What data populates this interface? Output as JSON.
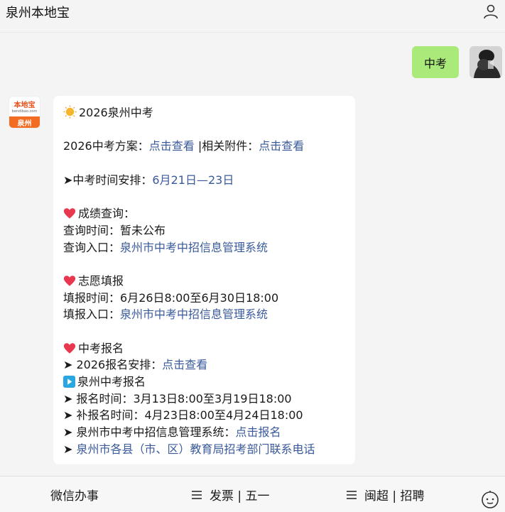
{
  "header": {
    "title": "泉州本地宝",
    "user_icon": "user-icon"
  },
  "messages": {
    "user": {
      "text": "中考",
      "avatar": "dark-photo-avatar"
    },
    "bot": {
      "avatar": {
        "logo_text": "本地宝",
        "logo_sub": "bendibao.com",
        "city": "泉州"
      },
      "title": "2026泉州中考",
      "plan_label": "2026中考方案：",
      "plan_link": "点击查看",
      "attach_label": " |相关附件：",
      "attach_link": "点击查看",
      "schedule_label": "➤中考时间安排：",
      "schedule_value": "6月21日—23日",
      "score_heading": "成绩查询：",
      "score_time_label": "查询时间：",
      "score_time_value": "暂未公布",
      "score_entry_label": "查询入口：",
      "score_entry_link": "泉州市中考中招信息管理系统",
      "wish_heading": "志愿填报",
      "wish_time_label": "填报时间：",
      "wish_time_value": "6月26日8:00至6月30日18:00",
      "wish_entry_label": "填报入口：",
      "wish_entry_link": "泉州市中考中招信息管理系统",
      "reg_heading": "中考报名",
      "reg_plan_label": "➤ 2026报名安排：",
      "reg_plan_link": "点击查看",
      "reg_sub_heading": "泉州中考报名",
      "reg_time": "➤ 报名时间：3月13日8:00至3月19日18:00",
      "reg_makeup": "➤ 补报名时间：4月23日8:00至4月24日18:00",
      "reg_system_label": "➤ 泉州市中考中招信息管理系统：",
      "reg_system_link": "点击报名",
      "reg_contact_prefix": "➤ ",
      "reg_contact_link": "泉州市各县（市、区）教育局招考部门联系电话"
    }
  },
  "bottom_menu": {
    "item1": "微信办事",
    "item2": "发票 | 五一",
    "item3": "闽超 | 招聘",
    "robot_icon": "robot-icon"
  },
  "colors": {
    "user_bubble": "#a9ea7a",
    "link": "#3a5a9b",
    "brand": "#f26c23"
  }
}
